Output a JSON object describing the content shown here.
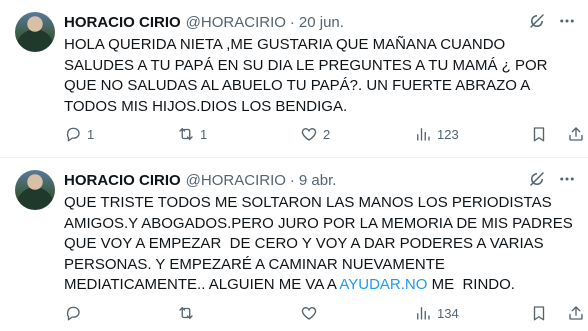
{
  "tweets": [
    {
      "name": "HORACIO CIRIO",
      "handle": "@HORACIRIO",
      "separator": "·",
      "date": "20 jun.",
      "text": "HOLA QUERIDA NIETA ,ME GUSTARIA QUE MAÑANA CUANDO SALUDES A TU PAPÁ EN SU DIA LE PREGUNTES A TU MAMÁ ¿ POR QUE NO SALUDAS AL ABUELO TU PAPÁ?. UN FUERTE ABRAZO A TODOS MIS HIJOS.DIOS LOS BENDIGA.",
      "replies": "1",
      "retweets": "1",
      "likes": "2",
      "views": "123"
    },
    {
      "name": "HORACIO CIRIO",
      "handle": "@HORACIRIO",
      "separator": "·",
      "date": "9 abr.",
      "text_before_link": "QUE TRISTE TODOS ME SOLTARON LAS MANOS LOS PERIODISTAS AMIGOS.Y ABOGADOS.PERO JURO POR LA MEMORIA DE MIS PADRES QUE VOY A EMPEZAR  DE CERO Y VOY A DAR PODERES A VARIAS PERSONAS. Y EMPEZARÉ A CAMINAR NUEVAMENTE MEDIATICAMENTE.. ALGUIEN ME VA A ",
      "link_text": "AYUDAR.NO",
      "text_after_link": " ME  RINDO.",
      "replies": "",
      "retweets": "",
      "likes": "",
      "views": "134"
    }
  ],
  "icons": {
    "grok": "grok-icon",
    "more": "more-icon",
    "reply": "reply-icon",
    "retweet": "retweet-icon",
    "like": "heart-icon",
    "views": "views-icon",
    "bookmark": "bookmark-icon",
    "share": "share-icon"
  },
  "colors": {
    "text": "#0f1419",
    "muted": "#536471",
    "link": "#1d9bf0",
    "divider": "#eff3f4"
  }
}
